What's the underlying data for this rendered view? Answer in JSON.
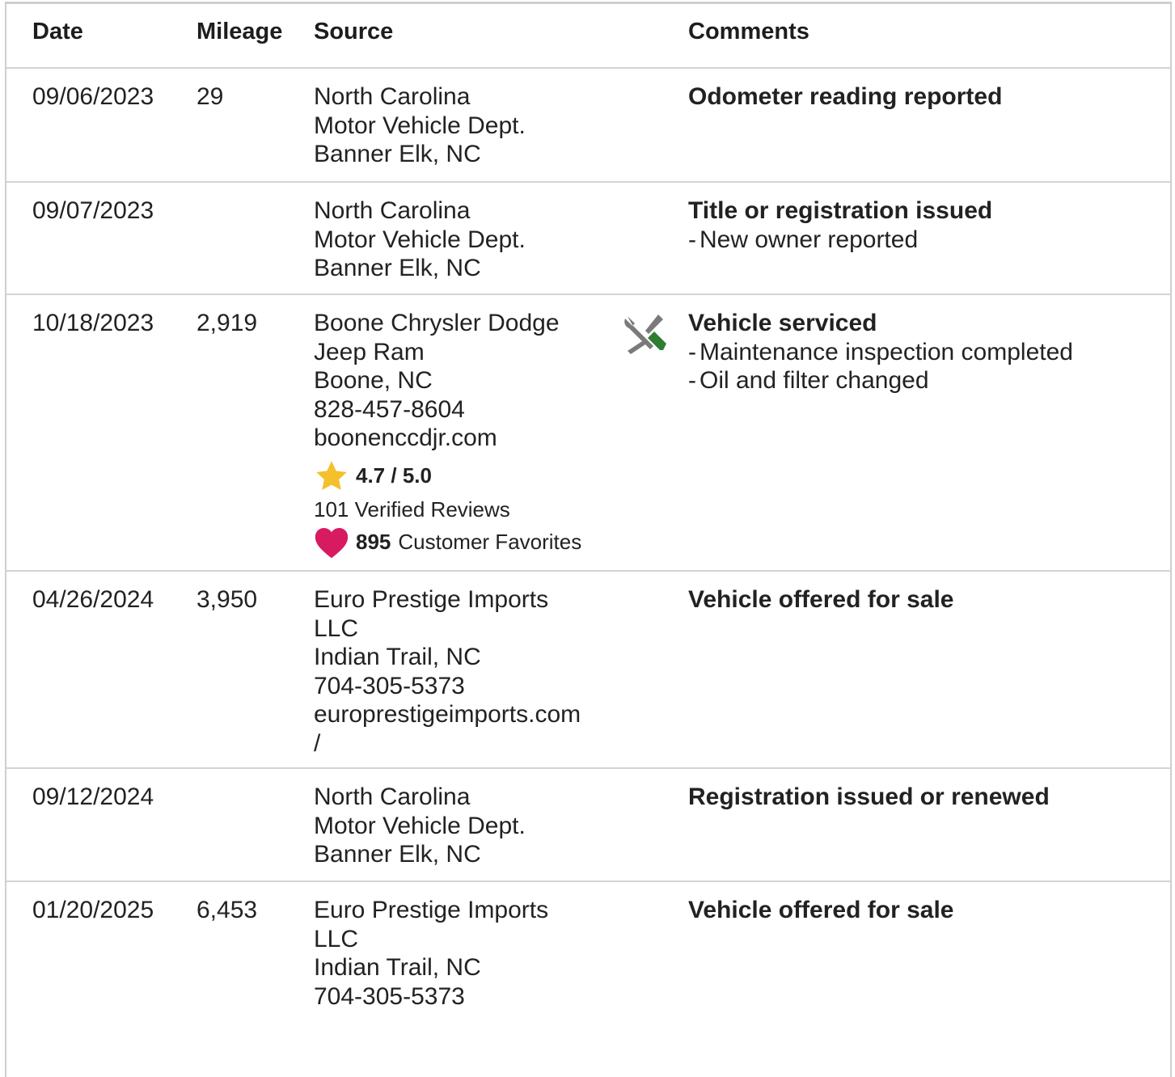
{
  "header": {
    "date": "Date",
    "mileage": "Mileage",
    "source": "Source",
    "comments": "Comments"
  },
  "rows": [
    {
      "date": "09/06/2023",
      "mileage": "29",
      "source": [
        "North Carolina",
        "Motor Vehicle Dept.",
        "Banner Elk, NC"
      ],
      "comment_title": "Odometer reading reported",
      "comment_items": []
    },
    {
      "date": "09/07/2023",
      "mileage": "",
      "source": [
        "North Carolina",
        "Motor Vehicle Dept.",
        "Banner Elk, NC"
      ],
      "comment_title": "Title or registration issued",
      "comment_items": [
        "New owner reported"
      ]
    },
    {
      "date": "10/18/2023",
      "mileage": "2,919",
      "source": [
        "Boone Chrysler Dodge",
        "Jeep Ram",
        "Boone, NC",
        "828-457-8604",
        "boonenccdjr.com"
      ],
      "rating": "4.7 / 5.0",
      "reviews": "101 Verified Reviews",
      "favorites_count": "895",
      "favorites_label": "Customer Favorites",
      "icon": "service-wrench-screwdriver-icon",
      "comment_title": "Vehicle serviced",
      "comment_items": [
        "Maintenance inspection completed",
        "Oil and filter changed"
      ]
    },
    {
      "date": "04/26/2024",
      "mileage": "3,950",
      "source": [
        "Euro Prestige Imports",
        "LLC",
        "Indian Trail, NC",
        "704-305-5373",
        "europrestigeimports.com",
        "/"
      ],
      "comment_title": "Vehicle offered for sale",
      "comment_items": []
    },
    {
      "date": "09/12/2024",
      "mileage": "",
      "source": [
        "North Carolina",
        "Motor Vehicle Dept.",
        "Banner Elk, NC"
      ],
      "comment_title": "Registration issued or renewed",
      "comment_items": []
    },
    {
      "date": "01/20/2025",
      "mileage": "6,453",
      "source": [
        "Euro Prestige Imports",
        "LLC",
        "Indian Trail, NC",
        "704-305-5373"
      ],
      "comment_title": "Vehicle offered for sale",
      "comment_items": []
    }
  ],
  "colors": {
    "star": "#f5c02c",
    "heart": "#d81b60",
    "tool_gray": "#7a7a7a",
    "tool_green": "#2e7d32",
    "border": "#d4d4d4"
  }
}
